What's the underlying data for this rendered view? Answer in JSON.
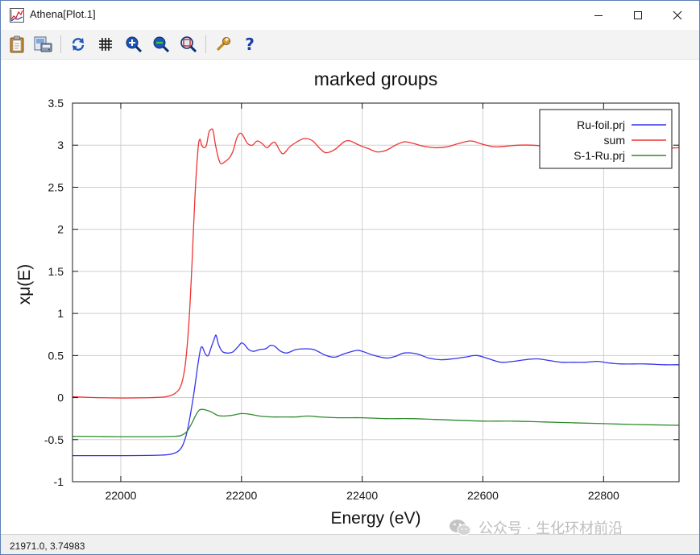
{
  "window": {
    "title": "Athena[Plot.1]",
    "controls": {
      "minimize": "minimize-icon",
      "maximize": "maximize-icon",
      "close": "close-icon"
    }
  },
  "toolbar": {
    "buttons": [
      {
        "name": "clipboard-icon"
      },
      {
        "name": "save-image-icon"
      },
      {
        "name": "refresh-icon"
      },
      {
        "name": "grid-icon"
      },
      {
        "name": "zoom-in-icon"
      },
      {
        "name": "zoom-out-icon"
      },
      {
        "name": "zoom-reset-icon"
      },
      {
        "name": "settings-icon"
      },
      {
        "name": "help-icon"
      }
    ]
  },
  "status": {
    "text": "21971.0,  3.74983"
  },
  "watermark": {
    "text": "公众号 · 生化环材前沿"
  },
  "chart_data": {
    "type": "line",
    "title": "marked groups",
    "xlabel": "Energy    (eV)",
    "ylabel": "xμ(E)",
    "xlim": [
      21920,
      22925
    ],
    "ylim": [
      -1,
      3.5
    ],
    "xticks": [
      22000,
      22200,
      22400,
      22600,
      22800
    ],
    "xtick_labels": [
      "22000",
      "22200",
      "22400",
      "22600",
      "22800"
    ],
    "yticks": [
      -1,
      -0.5,
      0,
      0.5,
      1,
      1.5,
      2,
      2.5,
      3,
      3.5
    ],
    "ytick_labels": [
      "-1",
      "-0.5",
      "0",
      "0.5",
      "1",
      "1.5",
      "2",
      "2.5",
      "3",
      "3.5"
    ],
    "grid": true,
    "legend_position": "top-right",
    "series": [
      {
        "name": "Ru-foil.prj",
        "color": "#3535ee",
        "points": [
          [
            21920,
            -0.69
          ],
          [
            22000,
            -0.69
          ],
          [
            22060,
            -0.685
          ],
          [
            22085,
            -0.67
          ],
          [
            22100,
            -0.6
          ],
          [
            22110,
            -0.4
          ],
          [
            22120,
            0.0
          ],
          [
            22128,
            0.4
          ],
          [
            22132,
            0.57
          ],
          [
            22135,
            0.6
          ],
          [
            22140,
            0.52
          ],
          [
            22145,
            0.5
          ],
          [
            22150,
            0.6
          ],
          [
            22155,
            0.7
          ],
          [
            22158,
            0.74
          ],
          [
            22162,
            0.63
          ],
          [
            22168,
            0.55
          ],
          [
            22175,
            0.53
          ],
          [
            22185,
            0.54
          ],
          [
            22195,
            0.61
          ],
          [
            22200,
            0.65
          ],
          [
            22205,
            0.63
          ],
          [
            22212,
            0.57
          ],
          [
            22220,
            0.55
          ],
          [
            22230,
            0.57
          ],
          [
            22240,
            0.58
          ],
          [
            22248,
            0.62
          ],
          [
            22255,
            0.61
          ],
          [
            22265,
            0.55
          ],
          [
            22275,
            0.53
          ],
          [
            22290,
            0.57
          ],
          [
            22305,
            0.58
          ],
          [
            22320,
            0.57
          ],
          [
            22340,
            0.5
          ],
          [
            22355,
            0.48
          ],
          [
            22370,
            0.52
          ],
          [
            22390,
            0.56
          ],
          [
            22400,
            0.55
          ],
          [
            22420,
            0.5
          ],
          [
            22440,
            0.47
          ],
          [
            22455,
            0.49
          ],
          [
            22470,
            0.53
          ],
          [
            22490,
            0.52
          ],
          [
            22510,
            0.47
          ],
          [
            22530,
            0.45
          ],
          [
            22550,
            0.46
          ],
          [
            22570,
            0.48
          ],
          [
            22590,
            0.5
          ],
          [
            22610,
            0.46
          ],
          [
            22630,
            0.42
          ],
          [
            22650,
            0.43
          ],
          [
            22670,
            0.45
          ],
          [
            22690,
            0.46
          ],
          [
            22710,
            0.44
          ],
          [
            22730,
            0.42
          ],
          [
            22750,
            0.42
          ],
          [
            22770,
            0.42
          ],
          [
            22790,
            0.43
          ],
          [
            22810,
            0.41
          ],
          [
            22830,
            0.4
          ],
          [
            22850,
            0.4
          ],
          [
            22870,
            0.4
          ],
          [
            22900,
            0.39
          ],
          [
            22925,
            0.39
          ]
        ]
      },
      {
        "name": "sum",
        "color": "#ee3333",
        "points": [
          [
            21920,
            0.01
          ],
          [
            21960,
            0.0
          ],
          [
            22000,
            -0.005
          ],
          [
            22050,
            0.0
          ],
          [
            22075,
            0.01
          ],
          [
            22090,
            0.05
          ],
          [
            22100,
            0.15
          ],
          [
            22107,
            0.4
          ],
          [
            22113,
            0.9
          ],
          [
            22118,
            1.6
          ],
          [
            22123,
            2.4
          ],
          [
            22128,
            2.95
          ],
          [
            22131,
            3.07
          ],
          [
            22134,
            3.0
          ],
          [
            22138,
            2.97
          ],
          [
            22142,
            3.0
          ],
          [
            22146,
            3.15
          ],
          [
            22150,
            3.19
          ],
          [
            22153,
            3.17
          ],
          [
            22157,
            3.0
          ],
          [
            22162,
            2.84
          ],
          [
            22166,
            2.78
          ],
          [
            22172,
            2.8
          ],
          [
            22180,
            2.85
          ],
          [
            22186,
            2.93
          ],
          [
            22192,
            3.08
          ],
          [
            22197,
            3.14
          ],
          [
            22202,
            3.12
          ],
          [
            22210,
            3.02
          ],
          [
            22218,
            3.0
          ],
          [
            22226,
            3.05
          ],
          [
            22234,
            3.02
          ],
          [
            22242,
            2.97
          ],
          [
            22250,
            3.02
          ],
          [
            22256,
            3.03
          ],
          [
            22264,
            2.93
          ],
          [
            22270,
            2.9
          ],
          [
            22280,
            2.98
          ],
          [
            22292,
            3.04
          ],
          [
            22305,
            3.08
          ],
          [
            22318,
            3.05
          ],
          [
            22330,
            2.96
          ],
          [
            22340,
            2.91
          ],
          [
            22355,
            2.95
          ],
          [
            22370,
            3.04
          ],
          [
            22380,
            3.05
          ],
          [
            22395,
            3.0
          ],
          [
            22410,
            2.96
          ],
          [
            22425,
            2.92
          ],
          [
            22440,
            2.94
          ],
          [
            22455,
            3.0
          ],
          [
            22470,
            3.04
          ],
          [
            22485,
            3.02
          ],
          [
            22500,
            2.99
          ],
          [
            22520,
            2.97
          ],
          [
            22540,
            2.98
          ],
          [
            22560,
            3.02
          ],
          [
            22580,
            3.05
          ],
          [
            22600,
            3.01
          ],
          [
            22620,
            2.98
          ],
          [
            22640,
            2.99
          ],
          [
            22660,
            3.0
          ],
          [
            22680,
            3.0
          ],
          [
            22700,
            2.99
          ],
          [
            22720,
            2.98
          ],
          [
            22740,
            3.0
          ],
          [
            22760,
            3.0
          ],
          [
            22780,
            2.99
          ],
          [
            22800,
            3.0
          ],
          [
            22830,
            2.97
          ],
          [
            22860,
            2.97
          ],
          [
            22890,
            2.96
          ],
          [
            22925,
            2.97
          ]
        ]
      },
      {
        "name": "S-1-Ru.prj",
        "color": "#2e8b2e",
        "points": [
          [
            21920,
            -0.46
          ],
          [
            22000,
            -0.465
          ],
          [
            22060,
            -0.465
          ],
          [
            22090,
            -0.46
          ],
          [
            22100,
            -0.45
          ],
          [
            22110,
            -0.4
          ],
          [
            22118,
            -0.3
          ],
          [
            22125,
            -0.2
          ],
          [
            22130,
            -0.15
          ],
          [
            22135,
            -0.14
          ],
          [
            22142,
            -0.15
          ],
          [
            22150,
            -0.17
          ],
          [
            22160,
            -0.21
          ],
          [
            22170,
            -0.22
          ],
          [
            22185,
            -0.21
          ],
          [
            22200,
            -0.19
          ],
          [
            22215,
            -0.2
          ],
          [
            22230,
            -0.22
          ],
          [
            22250,
            -0.23
          ],
          [
            22270,
            -0.23
          ],
          [
            22290,
            -0.23
          ],
          [
            22310,
            -0.22
          ],
          [
            22330,
            -0.23
          ],
          [
            22360,
            -0.24
          ],
          [
            22400,
            -0.24
          ],
          [
            22440,
            -0.25
          ],
          [
            22480,
            -0.25
          ],
          [
            22520,
            -0.26
          ],
          [
            22560,
            -0.27
          ],
          [
            22600,
            -0.28
          ],
          [
            22650,
            -0.28
          ],
          [
            22700,
            -0.29
          ],
          [
            22750,
            -0.3
          ],
          [
            22800,
            -0.31
          ],
          [
            22850,
            -0.32
          ],
          [
            22925,
            -0.33
          ]
        ]
      }
    ]
  }
}
